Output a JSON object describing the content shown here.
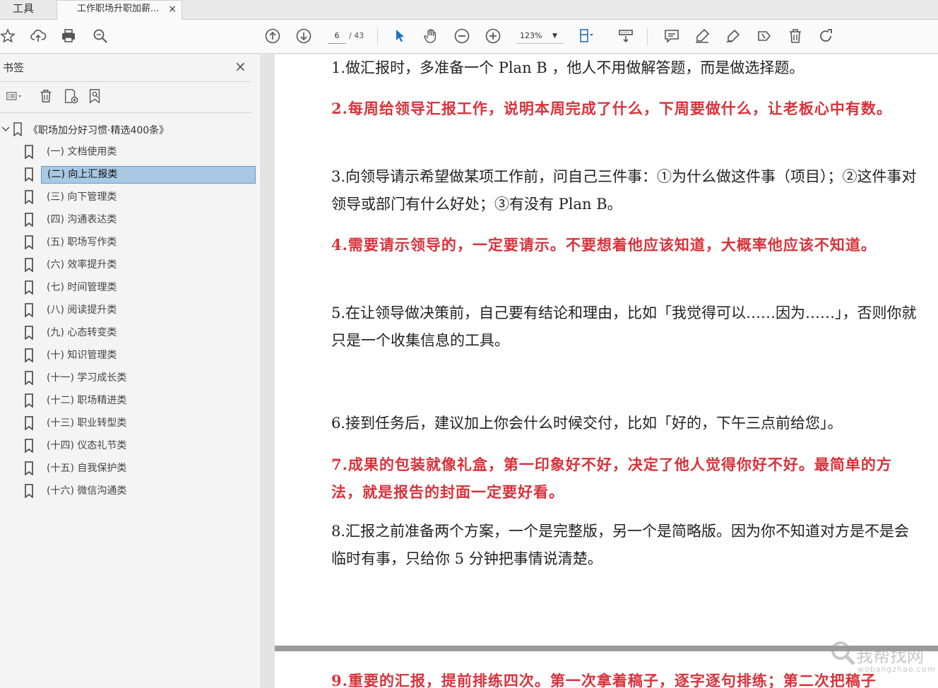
{
  "tabs": {
    "tools": "工具",
    "document": "工作职场升职加薪...",
    "close": "×"
  },
  "toolbar": {
    "page_current": "6",
    "page_total": "/ 43",
    "zoom": "123%"
  },
  "sidebar": {
    "title": "书签",
    "close": "×",
    "root": "《职场加分好习惯·精选400条》",
    "items": [
      {
        "label": "(一) 文档使用类"
      },
      {
        "label": "(二) 向上汇报类",
        "selected": true
      },
      {
        "label": "(三) 向下管理类"
      },
      {
        "label": "(四) 沟通表达类"
      },
      {
        "label": "(五) 职场写作类"
      },
      {
        "label": "(六) 效率提升类"
      },
      {
        "label": "(七)  时间管理类"
      },
      {
        "label": "(八) 阅读提升类"
      },
      {
        "label": "(九) 心态转变类"
      },
      {
        "label": "(十)  知识管理类"
      },
      {
        "label": "(十一) 学习成长类"
      },
      {
        "label": "(十二) 职场精进类"
      },
      {
        "label": "(十三) 职业转型类"
      },
      {
        "label": "(十四) 仪态礼节类"
      },
      {
        "label": "(十五) 自我保护类"
      },
      {
        "label": "(十六) 微信沟通类"
      }
    ]
  },
  "document": {
    "paragraphs": [
      {
        "text": "1.做汇报时，多准备一个 Plan B ，他人不用做解答题，而是做选择题。",
        "red": false
      },
      {
        "text": "2.每周给领导汇报工作，说明本周完成了什么，下周要做什么，让老板心中有数。",
        "red": true
      },
      {
        "text": "3.向领导请示希望做某项工作前，问自己三件事：①为什么做这件事（项目）；②这件事对领导或部门有什么好处；③有没有 Plan B。",
        "red": false
      },
      {
        "text": "4.需要请示领导的，一定要请示。不要想着他应该知道，大概率他应该不知道。",
        "red": true
      },
      {
        "text": "5.在让领导做决策前，自己要有结论和理由，比如「我觉得可以……因为……」，否则你就只是一个收集信息的工具。",
        "red": false
      },
      {
        "text": "6.接到任务后，建议加上你会什么时候交付，比如「好的，下午三点前给您」。",
        "red": false
      },
      {
        "text": "7.成果的包装就像礼盒，第一印象好不好，决定了他人觉得你好不好。最简单的方法，就是报告的封面一定要好看。",
        "red": true
      },
      {
        "text": "8.汇报之前准备两个方案，一个是完整版，另一个是简略版。因为你不知道对方是不是会临时有事，只给你 5 分钟把事情说清楚。",
        "red": false
      }
    ],
    "next_page_paragraph": "9.重要的汇报，提前排练四次。第一次拿着稿子，逐字逐句排练；第二次把稿子"
  },
  "watermark": {
    "text": "我帮找网",
    "sub": "wobangzhao.com"
  },
  "colors": {
    "red_text": "#d9323a",
    "selection": "#a8c8e4"
  }
}
